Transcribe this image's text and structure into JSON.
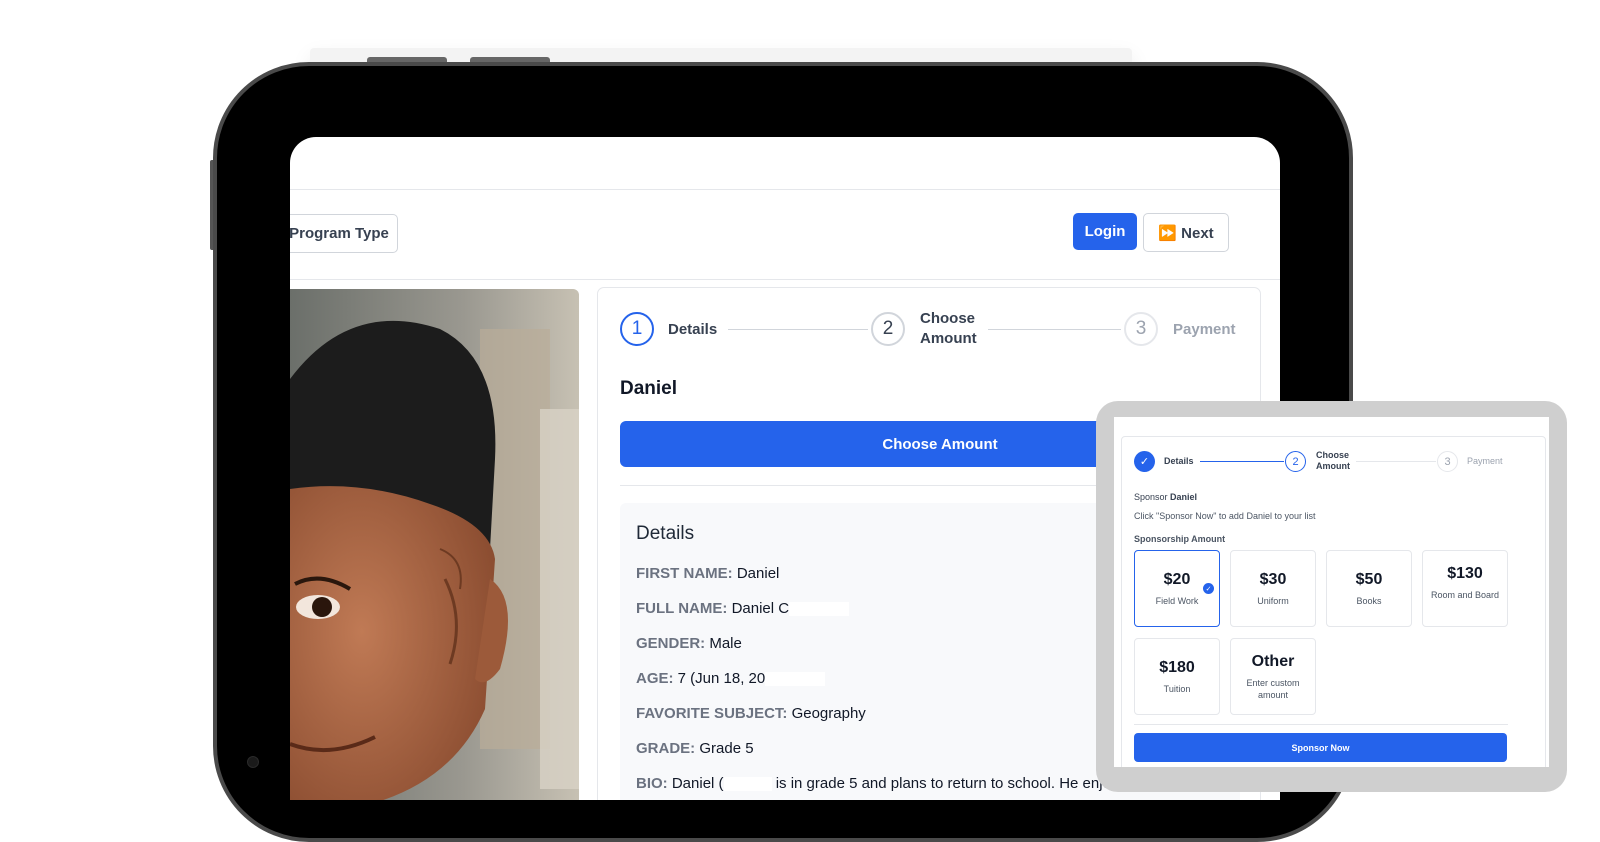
{
  "navbar": {
    "program_type_label": "Program Type",
    "login_label": "Login",
    "next_label": "⏩ Next"
  },
  "stepper": {
    "steps": [
      {
        "number": "1",
        "label": "Details"
      },
      {
        "number": "2",
        "label": "Choose Amount"
      },
      {
        "number": "3",
        "label": "Payment"
      }
    ]
  },
  "child": {
    "name": "Daniel",
    "choose_amount_label": "Choose Amount"
  },
  "details": {
    "title": "Details",
    "fields": [
      {
        "key": "FIRST NAME:",
        "value": "Daniel"
      },
      {
        "key": "FULL NAME:",
        "value": "Daniel C"
      },
      {
        "key": "GENDER:",
        "value": "Male"
      },
      {
        "key": "AGE:",
        "value": "7 (Jun 18, 20"
      },
      {
        "key": "FAVORITE SUBJECT:",
        "value": "Geography"
      },
      {
        "key": "GRADE:",
        "value": "Grade 5"
      },
      {
        "key": "BIO:",
        "value": "Daniel (",
        "value_rest": "is in grade 5 and plans to return to school. He enjoys singing"
      }
    ]
  },
  "overlay": {
    "steps": [
      {
        "number": "✓",
        "label": "Details"
      },
      {
        "number": "2",
        "label": "Choose Amount"
      },
      {
        "number": "3",
        "label": "Payment"
      }
    ],
    "sponsor_prefix": "Sponsor",
    "sponsor_name": "Daniel",
    "instruction": "Click \"Sponsor Now\" to add Daniel to your list",
    "amount_heading": "Sponsorship Amount",
    "amounts": [
      {
        "value": "$20",
        "label": "Field Work",
        "selected": true
      },
      {
        "value": "$30",
        "label": "Uniform"
      },
      {
        "value": "$50",
        "label": "Books"
      },
      {
        "value": "$130",
        "label": "Room and Board"
      },
      {
        "value": "$180",
        "label": "Tuition"
      },
      {
        "value": "Other",
        "label": "Enter custom amount"
      }
    ],
    "sponsor_button_label": "Sponsor Now"
  },
  "colors": {
    "accent": "#2563eb",
    "device_frame": "#000000"
  }
}
